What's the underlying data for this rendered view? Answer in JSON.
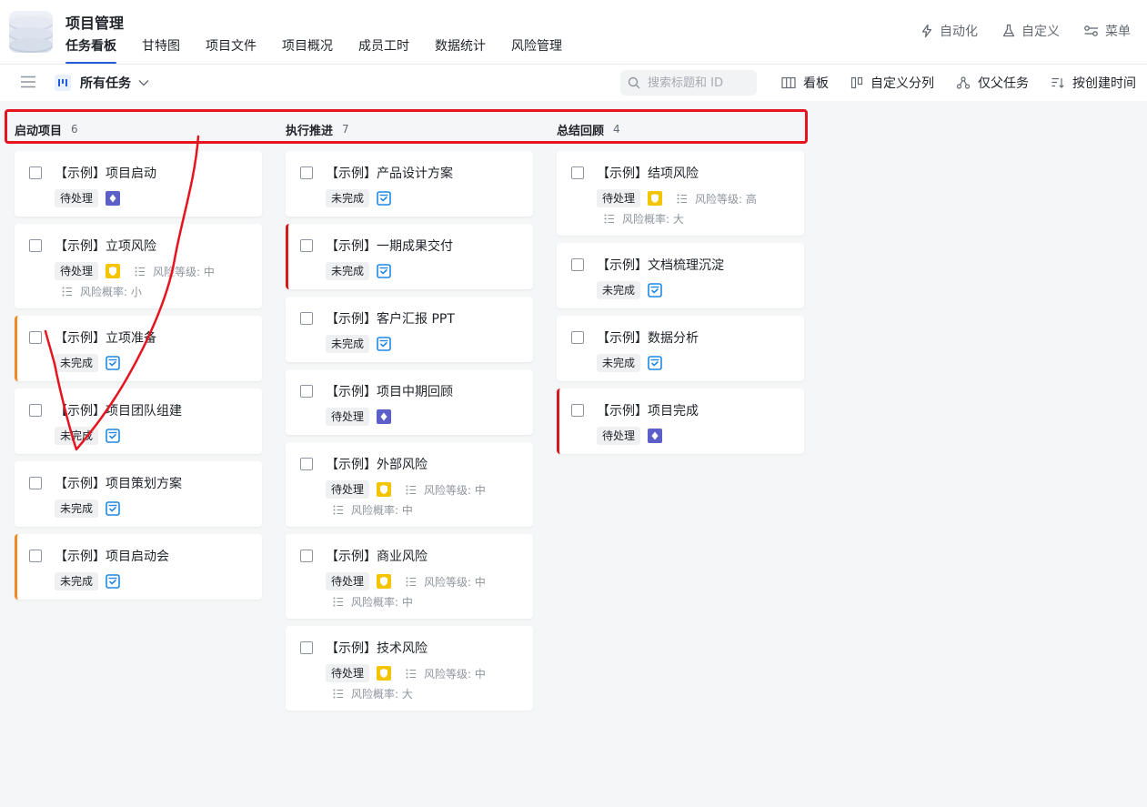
{
  "app": {
    "title": "项目管理",
    "tabs": [
      "任务看板",
      "甘特图",
      "项目文件",
      "项目概况",
      "成员工时",
      "数据统计",
      "风险管理"
    ],
    "active_tab": 0,
    "actions": [
      {
        "label": "自动化",
        "icon": "lightning-icon"
      },
      {
        "label": "自定义",
        "icon": "flask-icon"
      },
      {
        "label": "菜单",
        "icon": "settings-sliders-icon"
      }
    ]
  },
  "toolbar": {
    "view_label": "所有任务",
    "search_placeholder": "搜索标题和 ID",
    "actions": [
      {
        "label": "看板",
        "icon": "board-icon"
      },
      {
        "label": "自定义分列",
        "icon": "columns-icon"
      },
      {
        "label": "仅父任务",
        "icon": "hierarchy-icon"
      },
      {
        "label": "按创建时间",
        "icon": "sort-icon"
      }
    ]
  },
  "colors": {
    "accent": "#245bdb",
    "orange": "#f08a24",
    "red": "#d7191f",
    "annotation": "#e5141f"
  },
  "columns": [
    {
      "title": "启动项目",
      "count": "6",
      "cards": [
        {
          "title": "【示例】项目启动",
          "status": "待处理",
          "type": "milestone-icon",
          "accent": ""
        },
        {
          "title": "【示例】立项风险",
          "status": "待处理",
          "type": "risk-shield-icon",
          "accent": "",
          "risk_level": "风险等级: 中",
          "risk_prob": "风险概率: 小"
        },
        {
          "title": "【示例】立项准备",
          "status": "未完成",
          "type": "task-check-icon",
          "accent": "orange"
        },
        {
          "title": "【示例】项目团队组建",
          "status": "未完成",
          "type": "task-check-icon",
          "accent": ""
        },
        {
          "title": "【示例】项目策划方案",
          "status": "未完成",
          "type": "task-check-icon",
          "accent": ""
        },
        {
          "title": "【示例】项目启动会",
          "status": "未完成",
          "type": "task-check-icon",
          "accent": "orange"
        }
      ]
    },
    {
      "title": "执行推进",
      "count": "7",
      "cards": [
        {
          "title": "【示例】产品设计方案",
          "status": "未完成",
          "type": "task-check-icon",
          "accent": ""
        },
        {
          "title": "【示例】一期成果交付",
          "status": "未完成",
          "type": "task-check-icon",
          "accent": "red"
        },
        {
          "title": "【示例】客户汇报 PPT",
          "status": "未完成",
          "type": "task-check-icon",
          "accent": ""
        },
        {
          "title": "【示例】项目中期回顾",
          "status": "待处理",
          "type": "milestone-icon",
          "accent": ""
        },
        {
          "title": "【示例】外部风险",
          "status": "待处理",
          "type": "risk-shield-icon",
          "accent": "",
          "risk_level": "风险等级: 中",
          "risk_prob": "风险概率: 中"
        },
        {
          "title": "【示例】商业风险",
          "status": "待处理",
          "type": "risk-shield-icon",
          "accent": "",
          "risk_level": "风险等级: 中",
          "risk_prob": "风险概率: 中"
        },
        {
          "title": "【示例】技术风险",
          "status": "待处理",
          "type": "risk-shield-icon",
          "accent": "",
          "risk_level": "风险等级: 中",
          "risk_prob": "风险概率: 大"
        }
      ]
    },
    {
      "title": "总结回顾",
      "count": "4",
      "cards": [
        {
          "title": "【示例】结项风险",
          "status": "待处理",
          "type": "risk-shield-icon",
          "accent": "",
          "risk_level": "风险等级: 高",
          "risk_prob": "风险概率: 大"
        },
        {
          "title": "【示例】文档梳理沉淀",
          "status": "未完成",
          "type": "task-check-icon",
          "accent": ""
        },
        {
          "title": "【示例】数据分析",
          "status": "未完成",
          "type": "task-check-icon",
          "accent": ""
        },
        {
          "title": "【示例】项目完成",
          "status": "待处理",
          "type": "milestone-icon",
          "accent": "red"
        }
      ]
    }
  ]
}
